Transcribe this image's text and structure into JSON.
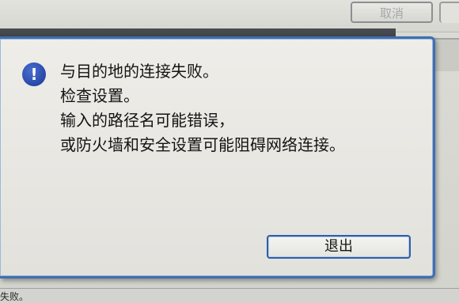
{
  "background_window": {
    "cancel_label": "取消",
    "status_text": "失败。"
  },
  "dialog": {
    "icon": "exclamation-info-icon",
    "icon_glyph": "!",
    "message_lines": [
      "与目的地的连接失败。",
      "检查设置。",
      "输入的路径名可能错误，",
      "或防火墙和安全设置可能阻碍网络连接。"
    ],
    "exit_label": "退出"
  },
  "colors": {
    "accent_border": "#3e6fb0",
    "icon_blue": "#2848a8"
  }
}
